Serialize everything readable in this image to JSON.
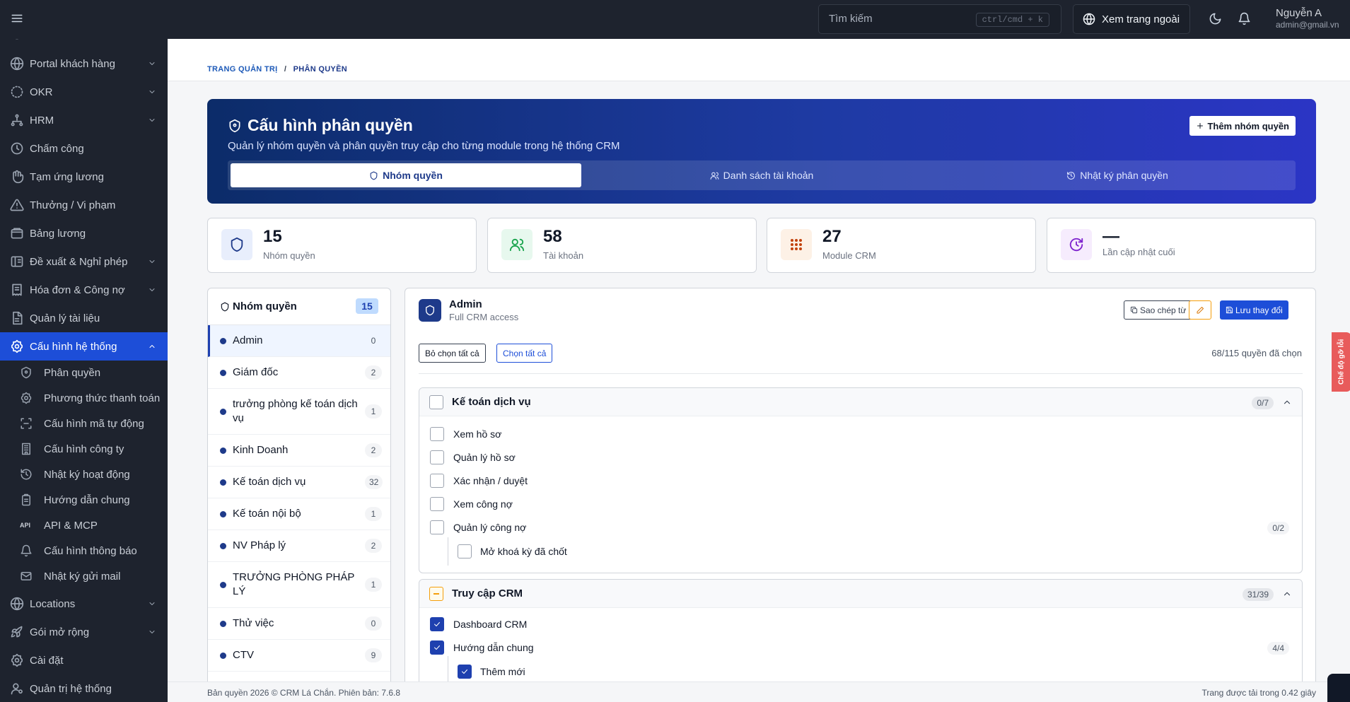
{
  "topbar": {
    "search_placeholder": "Tìm kiếm",
    "shortcut": "ctrl/cmd + k",
    "view_site": "Xem trang ngoài",
    "user_name": "Nguyễn A",
    "user_email": "admin@gmail.vn"
  },
  "sidebar": {
    "items": [
      {
        "label": "Portal khách hàng",
        "icon": "globe-icon",
        "chevron": "down"
      },
      {
        "label": "OKR",
        "icon": "loader-icon",
        "chevron": "down"
      },
      {
        "label": "HRM",
        "icon": "network-icon",
        "chevron": "down"
      },
      {
        "label": "Chấm công",
        "icon": "clock-icon"
      },
      {
        "label": "Tạm ứng lương",
        "icon": "hand-icon"
      },
      {
        "label": "Thưởng / Vi phạm",
        "icon": "warning-icon"
      },
      {
        "label": "Bảng lương",
        "icon": "wallet-icon"
      },
      {
        "label": "Đề xuất & Nghỉ phép",
        "icon": "columns-icon",
        "chevron": "down"
      },
      {
        "label": "Hóa đơn & Công nợ",
        "icon": "receipt-icon",
        "chevron": "down"
      },
      {
        "label": "Quản lý tài liệu",
        "icon": "file-icon"
      },
      {
        "label": "Cấu hình hệ thống",
        "icon": "settings-icon",
        "chevron": "up",
        "active": true
      }
    ],
    "sub_items": [
      {
        "label": "Phân quyền",
        "icon": "shield-icon"
      },
      {
        "label": "Phương thức thanh toán",
        "icon": "gear-icon"
      },
      {
        "label": "Cấu hình mã tự động",
        "icon": "scan-icon"
      },
      {
        "label": "Cấu hình công ty",
        "icon": "building-icon"
      },
      {
        "label": "Nhật ký hoạt động",
        "icon": "history-icon"
      },
      {
        "label": "Hướng dẫn chung",
        "icon": "clipboard-icon"
      },
      {
        "label": "API & MCP",
        "icon": "api-icon",
        "icon_text": "API"
      },
      {
        "label": "Cấu hình thông báo",
        "icon": "bell-icon"
      },
      {
        "label": "Nhật ký gửi mail",
        "icon": "mail-icon"
      }
    ],
    "bottom_items": [
      {
        "label": "Locations",
        "icon": "globe-icon",
        "chevron": "down"
      },
      {
        "label": "Gói mở rộng",
        "icon": "rocket-icon",
        "chevron": "down"
      },
      {
        "label": "Cài đặt",
        "icon": "settings-icon"
      },
      {
        "label": "Quản trị hệ thống",
        "icon": "user-cog-icon"
      }
    ]
  },
  "breadcrumb": {
    "root": "TRANG QUẢN TRỊ",
    "sep": "/",
    "current": "PHÂN QUYỀN"
  },
  "hero": {
    "title": "Cấu hình phân quyền",
    "subtitle": "Quản lý nhóm quyền và phân quyền truy cập cho từng module trong hệ thống CRM",
    "add_button": "Thêm nhóm quyền",
    "tabs": [
      {
        "label": "Nhóm quyền",
        "icon": "shield-icon",
        "active": true
      },
      {
        "label": "Danh sách tài khoản",
        "icon": "users-icon"
      },
      {
        "label": "Nhật ký phân quyền",
        "icon": "history-icon"
      }
    ]
  },
  "stats": [
    {
      "value": "15",
      "label": "Nhóm quyền",
      "icon": "shield-icon",
      "color": "#1e3a8a",
      "bg": "#e8eefc"
    },
    {
      "value": "58",
      "label": "Tài khoản",
      "icon": "users-icon",
      "color": "#16a34a",
      "bg": "#e7f8ee"
    },
    {
      "value": "27",
      "label": "Module CRM",
      "icon": "grid-icon",
      "color": "#c2410c",
      "bg": "#fdf1e6"
    },
    {
      "value": "—",
      "label": "Lần cập nhật cuối",
      "icon": "refresh-icon",
      "color": "#7e22ce",
      "bg": "#f6ecfd"
    }
  ],
  "groups": {
    "title": "Nhóm quyền",
    "count": "15",
    "items": [
      {
        "name": "Admin",
        "count": "0",
        "active": true
      },
      {
        "name": "Giám đốc",
        "count": "2"
      },
      {
        "name": "trưởng phòng kế toán dịch vụ",
        "count": "1"
      },
      {
        "name": "Kinh Doanh",
        "count": "2"
      },
      {
        "name": "Kế toán dịch vụ",
        "count": "32"
      },
      {
        "name": "Kế toán nội bộ",
        "count": "1"
      },
      {
        "name": "NV Pháp lý",
        "count": "2"
      },
      {
        "name": "TRƯỞNG PHÒNG PHÁP LÝ",
        "count": "1"
      },
      {
        "name": "Thử việc",
        "count": "0"
      },
      {
        "name": "CTV",
        "count": "9"
      }
    ]
  },
  "permissions": {
    "group_name": "Admin",
    "group_desc": "Full CRM access",
    "copy_button": "Sao chép từ",
    "save_button": "Lưu thay đổi",
    "deselect_all": "Bỏ chọn tất cả",
    "select_all": "Chọn tất cả",
    "selected_count": "68/115 quyền đã chọn",
    "modules": [
      {
        "title": "Kế toán dịch vụ",
        "badge": "0/7",
        "state": "none",
        "items": [
          {
            "label": "Xem hồ sơ",
            "checked": false
          },
          {
            "label": "Quản lý hồ sơ",
            "checked": false
          },
          {
            "label": "Xác nhận / duyệt",
            "checked": false
          },
          {
            "label": "Xem công nợ",
            "checked": false
          },
          {
            "label": "Quản lý công nợ",
            "checked": false,
            "badge": "0/2"
          },
          {
            "label": "Mở khoá kỳ đã chốt",
            "checked": false,
            "child": true
          }
        ]
      },
      {
        "title": "Truy cập CRM",
        "badge": "31/39",
        "state": "partial",
        "items": [
          {
            "label": "Dashboard CRM",
            "checked": true
          },
          {
            "label": "Hướng dẫn chung",
            "checked": true,
            "badge": "4/4"
          },
          {
            "label": "Thêm mới",
            "checked": true,
            "child": true
          }
        ]
      }
    ]
  },
  "footer": {
    "copyright": "Bản quyền 2026 © CRM Lá Chắn. Phiên bản: 7.6.8",
    "load_time": "Trang được tải trong 0.42 giây"
  },
  "bug_tab": "Chế độ gỡ lỗi"
}
